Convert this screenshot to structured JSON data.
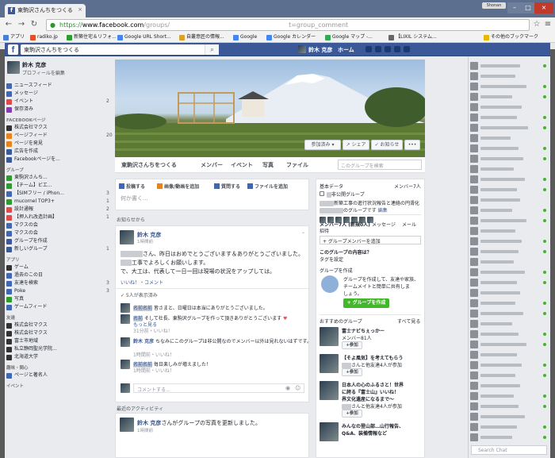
{
  "browser": {
    "tab_title": "東駒沢さんちをつくる",
    "url_scheme": "https://",
    "url_host": "www.facebook.com",
    "url_path": "/groups/",
    "url_query": "t=group_comment",
    "window_badge": "Shonan"
  },
  "bookmarks": [
    {
      "label": "アプリ",
      "color": "#4a7fd6"
    },
    {
      "label": "radiko.jp",
      "color": "#e0502a"
    },
    {
      "label": "新築住宅＆リフォ...",
      "color": "#2c9c2c"
    },
    {
      "label": "Google URL Short...",
      "color": "#4285f4"
    },
    {
      "label": "自叢意匠の情報...",
      "color": "#d9a22a"
    },
    {
      "label": "Google",
      "color": "#4285f4"
    },
    {
      "label": "Google カレンダー",
      "color": "#4285f4"
    },
    {
      "label": "Google マップ -...",
      "color": "#34a853"
    },
    {
      "label": "【LIXIL システム...",
      "color": "#666"
    },
    {
      "label": "その他のブックマーク",
      "color": "#e6b800"
    }
  ],
  "fb_header": {
    "search_value": "東駒沢さんちをつくる",
    "user_name": "鈴木 克彦",
    "home": "ホーム"
  },
  "left": {
    "profile_name": "鈴木 克彦",
    "profile_edit": "プロフィールを編集",
    "items_top": [
      {
        "label": "ニュースフィード",
        "count": "",
        "color": "#4267b2"
      },
      {
        "label": "メッセージ",
        "count": "",
        "color": "#4267b2"
      },
      {
        "label": "イベント",
        "count": "2",
        "color": "#e04a4a"
      },
      {
        "label": "保存済み",
        "count": "",
        "color": "#8a3ab9"
      }
    ],
    "section_pages": "FACEBOOKページ",
    "items_pages": [
      {
        "label": "株式会社マクス",
        "count": "",
        "color": "#333"
      },
      {
        "label": "ページフィード",
        "count": "20+",
        "color": "#e8831c"
      },
      {
        "label": "ページを発見",
        "count": "",
        "color": "#e8831c"
      },
      {
        "label": "広告を作成",
        "count": "",
        "color": "#3b5998"
      },
      {
        "label": "Facebookページを...",
        "count": "",
        "color": "#3b5998"
      }
    ],
    "section_groups": "グループ",
    "items_groups": [
      {
        "label": "東駒沢さんち...",
        "count": "",
        "color": "#2c9c2c"
      },
      {
        "label": "【チーム】ビエ...",
        "count": "",
        "color": "#2c9c2c"
      },
      {
        "label": "【SIMフリー / iPhon...",
        "count": "3",
        "color": "#4267b2"
      },
      {
        "label": "mucornel TOP3+",
        "count": "1",
        "color": "#2c9c2c"
      },
      {
        "label": "設計通報",
        "count": "2",
        "color": "#e04a4a"
      },
      {
        "label": "【押入れ改造計画】",
        "count": "1",
        "color": "#e04a4a"
      },
      {
        "label": "マクスの会",
        "count": "",
        "color": "#4267b2"
      },
      {
        "label": "マクスの会",
        "count": "",
        "color": "#4267b2"
      },
      {
        "label": "グループを作成",
        "count": "",
        "color": "#3b5998"
      },
      {
        "label": "新しいグループ",
        "count": "1",
        "color": "#3b5998"
      }
    ],
    "section_apps": "アプリ",
    "items_apps": [
      {
        "label": "ゲーム",
        "count": "",
        "color": "#333"
      },
      {
        "label": "過去のこの日",
        "count": "",
        "color": "#4267b2"
      },
      {
        "label": "友達を検索",
        "count": "3",
        "color": "#4267b2"
      },
      {
        "label": "Poke",
        "count": "3",
        "color": "#4267b2"
      },
      {
        "label": "写真",
        "count": "",
        "color": "#2c9c2c"
      },
      {
        "label": "ゲームフィード",
        "count": "",
        "color": "#4267b2"
      }
    ],
    "section_friends": "友達",
    "items_friends": [
      {
        "label": "株式会社マクス",
        "count": "",
        "color": "#333"
      },
      {
        "label": "株式会社マクス",
        "count": "",
        "color": "#333"
      },
      {
        "label": "富士市地域",
        "count": "",
        "color": "#333"
      },
      {
        "label": "私立静岡聖光学院...",
        "count": "",
        "color": "#333"
      },
      {
        "label": "北海道大学",
        "count": "",
        "color": "#333"
      }
    ],
    "section_interests": "趣味・関心",
    "items_interests": [
      {
        "label": "ページと著名人",
        "count": "",
        "color": "#4267b2"
      }
    ],
    "section_events": "イベント"
  },
  "cover_buttons": {
    "joined": "参加済み ▾",
    "share": "↗ シェア",
    "notify": "✓ お知らせ",
    "more": "•••"
  },
  "group_tabs": {
    "name": "東駒沢さんちをつくる",
    "members": "メンバー",
    "events": "イベント",
    "photos": "写真",
    "files": "ファイル",
    "search_placeholder": "このグループを検索"
  },
  "composer": {
    "post": "投稿する",
    "photo": "画像/動画を追加",
    "question": "質問する",
    "file": "ファイルを追加",
    "placeholder": "何か書く..."
  },
  "feed_header": "お知らせから",
  "post": {
    "author": "鈴木 克彦",
    "time": "1時間前",
    "line1": "さん、昨日はおめでとうございます＆ありがとうございました。",
    "line2": "工事でよろしくお願いします。",
    "line3": "で、大工は、代表して一日一回は現場の状況をアップしては。",
    "actions": "いいね！・コメント",
    "seen": "✓ 5人が表示済み",
    "c1_text": "皆さまと、日曜日は本当にありがとうございました。",
    "c2_text": "そして社長、東駒沢グループを作って頂きありがとうございます",
    "c2_more": "もっと見る",
    "c2_meta": "31分前・いいね！",
    "c3_name": "鈴木 克彦",
    "c3_text": "ちなみにこのグループは非公開なのでメンバー以外は見れないはずです。",
    "c3_meta": "1時間前・いいね！",
    "c4_text": "毎日楽しみが増えました！",
    "c4_meta": "1時間前・いいね！",
    "comment_placeholder": "コメントする..."
  },
  "activity_header": "最近のアクティビティ",
  "post2": {
    "author": "鈴木 克彦",
    "text": "さんがグループの写真を更新しました。",
    "time": "1時間前"
  },
  "right": {
    "info_label": "基本データ",
    "members_link": "メンバー7人",
    "group_type": "非公開グループ",
    "desc1": "新築工事の進行状況報告と連絡の円滑化",
    "desc2": "のグループです",
    "edit": "編集",
    "members_line": "メンバー7人 (新規0人)",
    "message": "メッセージ",
    "email": "メール",
    "invite": "招待",
    "add_member": "+ グループメンバーを追加",
    "about_q": "このグループの内容は？",
    "add_tag": "タグを設定",
    "create_header": "グループを作成",
    "create_text1": "グループを作成して、友達や家族、",
    "create_text2": "チームメイトと簡単に共有しま",
    "create_text3": "しょう。",
    "create_button": "+ グループを作成",
    "suggest_header": "おすすめのグループ",
    "see_all": "すべて見る",
    "sugg1_title": "富士ナビちぇっかー",
    "sugg1_members": "メンバー81人",
    "sugg2_title": "【そよ風気】を考えてもらう",
    "sugg2_members": "さんと他友達4人が参加",
    "sugg3_title1": "日本人の心のふるさと！世界",
    "sugg3_title2": "に誇る『富士山』いいね！",
    "sugg3_title3": "界文化遺産になるまで～",
    "sugg3_members": "さんと他友達4人が参加",
    "sugg4_title1": "みんなの登山部…山行報告、",
    "sugg4_title2": "Q&A、装備情報など",
    "join": "+参加"
  },
  "chat": {
    "search_placeholder": "Search Chat"
  }
}
